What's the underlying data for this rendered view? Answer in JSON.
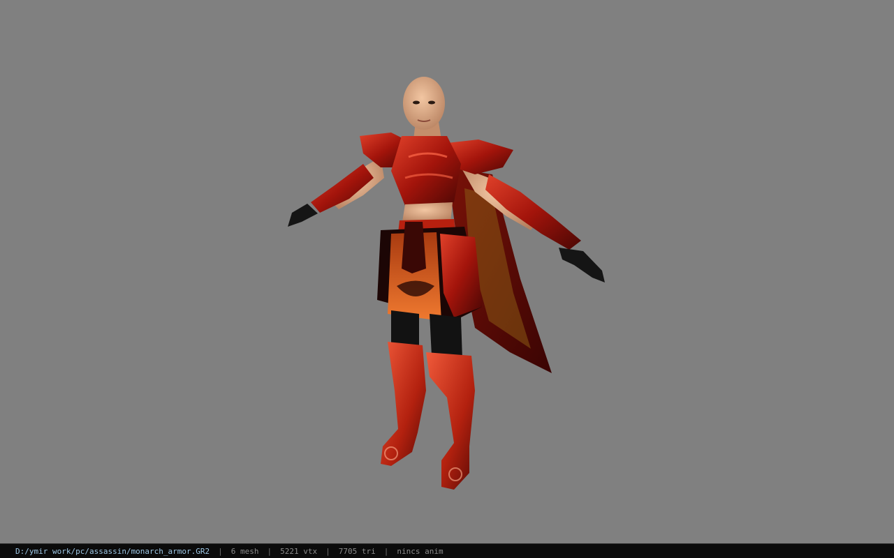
{
  "status": {
    "file_path": "D:/ymir work/pc/assassin/monarch_armor.GR2",
    "separator": "|",
    "mesh": "6 mesh",
    "vertices": "5221 vtx",
    "triangles": "7705 tri",
    "animation": "nincs anim"
  },
  "colors": {
    "background": "#808080",
    "status_bar": "#0b0b0b",
    "path_text": "#9fc8e6",
    "info_text": "#8c8c8c",
    "armor_red": "#b51a10",
    "armor_dark": "#3a0603",
    "skirt_orange": "#d05a14"
  },
  "model": {
    "icon": "character-model-preview"
  }
}
